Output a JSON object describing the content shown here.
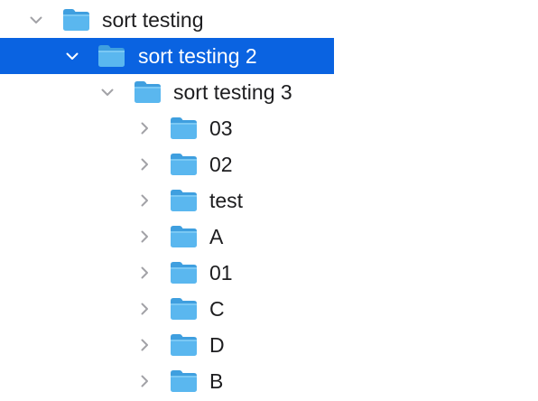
{
  "tree": {
    "items": [
      {
        "label": "sort testing",
        "expanded": true,
        "selected": false,
        "depth": 0
      },
      {
        "label": "sort testing 2",
        "expanded": true,
        "selected": true,
        "depth": 1
      },
      {
        "label": "sort testing 3",
        "expanded": true,
        "selected": false,
        "depth": 2
      },
      {
        "label": "03",
        "expanded": false,
        "selected": false,
        "depth": 3
      },
      {
        "label": "02",
        "expanded": false,
        "selected": false,
        "depth": 3
      },
      {
        "label": "test",
        "expanded": false,
        "selected": false,
        "depth": 3
      },
      {
        "label": "A",
        "expanded": false,
        "selected": false,
        "depth": 3
      },
      {
        "label": "01",
        "expanded": false,
        "selected": false,
        "depth": 3
      },
      {
        "label": "C",
        "expanded": false,
        "selected": false,
        "depth": 3
      },
      {
        "label": "D",
        "expanded": false,
        "selected": false,
        "depth": 3
      },
      {
        "label": "B",
        "expanded": false,
        "selected": false,
        "depth": 3
      }
    ]
  },
  "icons": {
    "folder": "folder-icon",
    "disclosure_open": "chevron-down-icon",
    "disclosure_closed": "chevron-right-icon"
  },
  "colors": {
    "selection": "#0a63e1",
    "selected_text": "#ffffff",
    "text": "#1d1d1f",
    "chevron": "#a2a2a7",
    "chevron_selected": "#ffffff",
    "folder_body": "#5ab7ef",
    "folder_tab": "#3f9fdf"
  }
}
